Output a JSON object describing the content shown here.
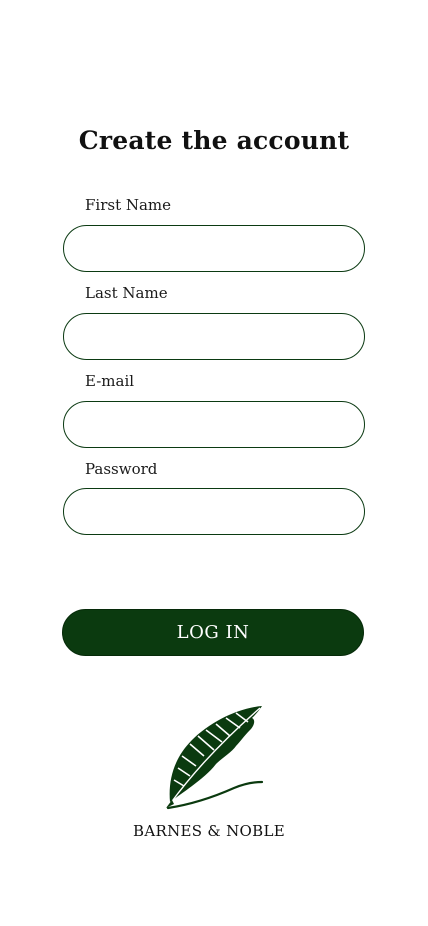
{
  "form": {
    "title": "Create the account",
    "fields": [
      {
        "label": "First Name",
        "value": "",
        "placeholder": ""
      },
      {
        "label": "Last Name",
        "value": "",
        "placeholder": ""
      },
      {
        "label": "E-mail",
        "value": "",
        "placeholder": ""
      },
      {
        "label": "Password",
        "value": "",
        "placeholder": ""
      }
    ],
    "submit_label": "LOG IN"
  },
  "brand": {
    "name": "BARNES & NOBLE",
    "logo_icon": "quill-feather-icon",
    "color": "#0b3a0f"
  }
}
